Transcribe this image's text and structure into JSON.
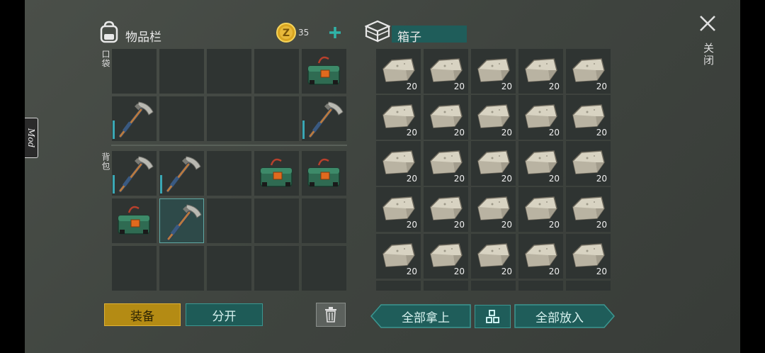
{
  "inventory": {
    "title": "物品栏",
    "coins": "35",
    "pocket_label": "口袋",
    "backpack_label": "背包",
    "equip_label": "装备",
    "split_label": "分开",
    "pocket_slots": [
      "empty",
      "empty",
      "empty",
      "empty",
      "toolbox",
      "pickaxe",
      "empty",
      "empty",
      "empty",
      "pickaxe"
    ],
    "backpack_slots": [
      "pickaxe",
      "pickaxe",
      "empty",
      "toolbox",
      "toolbox",
      "toolbox",
      "pickaxe-selected",
      "empty",
      "empty",
      "empty",
      "empty",
      "empty",
      "empty",
      "empty",
      "empty"
    ]
  },
  "box": {
    "title": "箱子",
    "stack_count": "20",
    "take_all_label": "全部拿上",
    "put_all_label": "全部放入"
  },
  "mod_label": "Mod",
  "close_label": "关闭",
  "colors": {
    "teal": "#1f5d5a",
    "gold": "#b48b14",
    "slot": "#2f3432"
  }
}
